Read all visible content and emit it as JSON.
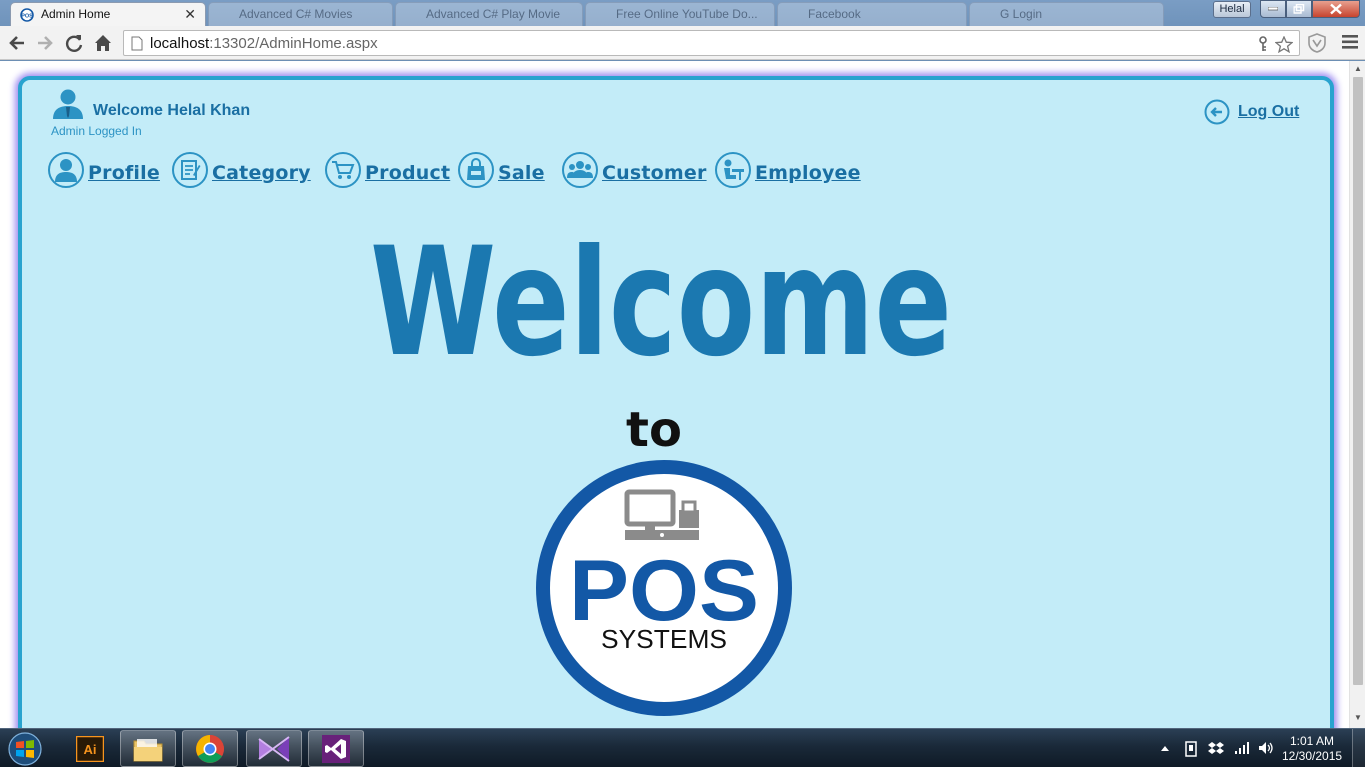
{
  "browser": {
    "active_tab": {
      "title": "Admin Home",
      "favicon": "pos-logo-icon"
    },
    "inactive_tabs": [
      {
        "title": "Advanced C# Movies"
      },
      {
        "title": "Advanced C# Play Movie"
      },
      {
        "title": "Free Online YouTube Do..."
      },
      {
        "title": "Facebook"
      },
      {
        "title": "G Login"
      }
    ],
    "profile_name": "Helal",
    "url_host": "localhost",
    "url_path": ":13302/AdminHome.aspx"
  },
  "header": {
    "welcome_text": "Welcome Helal Khan",
    "status_text": "Admin Logged In",
    "logout_label": "Log Out"
  },
  "nav": {
    "items": [
      {
        "label": "Profile",
        "icon": "profile-icon"
      },
      {
        "label": "Category",
        "icon": "category-icon"
      },
      {
        "label": "Product",
        "icon": "cart-icon"
      },
      {
        "label": "Sale",
        "icon": "sale-bag-icon"
      },
      {
        "label": "Customer",
        "icon": "customers-icon"
      },
      {
        "label": "Employee",
        "icon": "employee-icon"
      }
    ]
  },
  "hero": {
    "welcome": "Welcome",
    "to": "to",
    "logo_main": "POS",
    "logo_sub": "SYSTEMS"
  },
  "taskbar": {
    "apps": [
      "Adobe Illustrator",
      "Windows Explorer",
      "Google Chrome",
      "Visual Studio (MS)",
      "Visual Studio"
    ],
    "time": "1:01 AM",
    "date": "12/30/2015"
  },
  "colors": {
    "panel_bg": "#c3ecf8",
    "panel_border": "#29a3cf",
    "accent_text": "#1a6fa3",
    "welcome_fill": "#1b78b0",
    "logo_blue": "#1358a6"
  }
}
